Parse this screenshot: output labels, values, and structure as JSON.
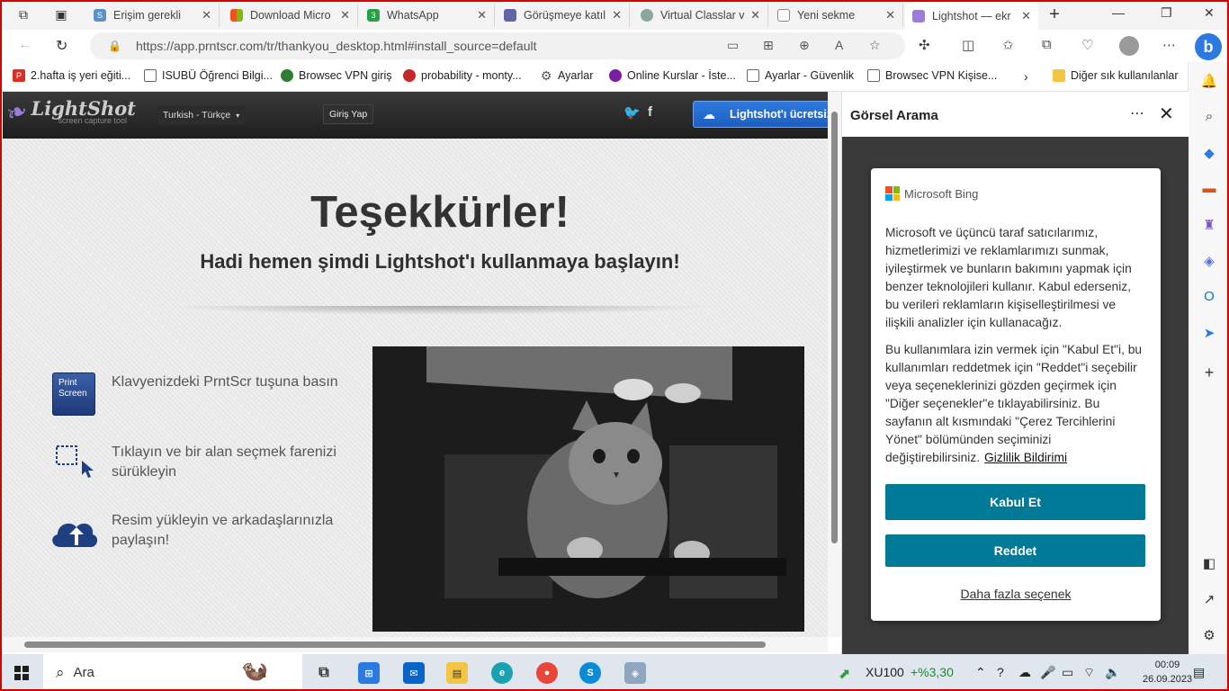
{
  "tabs": [
    {
      "label": "Erişim gerekli",
      "fav": "S",
      "color": "#5b93c9"
    },
    {
      "label": "Download Micro",
      "fav": "",
      "color": "#f25022"
    },
    {
      "label": "WhatsApp",
      "fav": "3",
      "color": "#25a244"
    },
    {
      "label": "Görüşmeye katıl",
      "fav": "",
      "color": "#6264a7"
    },
    {
      "label": "Virtual Classlar v",
      "fav": "",
      "color": "#8aa7a0"
    },
    {
      "label": "Yeni sekme",
      "fav": "",
      "color": "#999999"
    },
    {
      "label": "Lightshot — ekr",
      "fav": "",
      "color": "#9b7cd9"
    }
  ],
  "address": {
    "url": "https://app.prntscr.com/tr/thankyou_desktop.html#install_source=default"
  },
  "bookmarks": [
    {
      "label": "2.hafta iş yeri eğiti...",
      "color": "#d93025"
    },
    {
      "label": "ISUBÜ Öğrenci Bilgi...",
      "color": "#666666"
    },
    {
      "label": "Browsec VPN giriş",
      "color": "#2e7d32"
    },
    {
      "label": "probability - monty...",
      "color": "#c62828"
    },
    {
      "label": "Ayarlar",
      "color": "#555555"
    },
    {
      "label": "Online Kurslar - İste...",
      "color": "#7b1fa2"
    },
    {
      "label": "Ayarlar - Güvenlik",
      "color": "#666666"
    },
    {
      "label": "Browsec VPN Kişise...",
      "color": "#666666"
    }
  ],
  "bookmarks_other": "Diğer sık kullanılanlar",
  "lightshot": {
    "logo": "LightShot",
    "tagline": "screen capture tool",
    "language": "Turkish - Türkçe",
    "login": "Giriş Yap",
    "download": "Lightshot'ı ücretsiz",
    "title": "Teşekkürler!",
    "subtitle": "Hadi hemen şimdi Lightshot'ı kullanmaya başlayın!",
    "print_key": "Print Screen",
    "steps": [
      "Klavyenizdeki PrntScr tuşuna basın",
      "Tıklayın ve bir alan seçmek farenizi sürükleyin",
      "Resim yükleyin ve arkadaşlarınızla paylaşın!"
    ]
  },
  "panel": {
    "title": "Görsel Arama",
    "brand": "Microsoft Bing",
    "para1": "Microsoft ve üçüncü taraf satıcılarımız, hizmetlerimizi ve reklamlarımızı sunmak, iyileştirmek ve bunların bakımını yapmak için benzer teknolojileri kullanır. Kabul ederseniz, bu verileri reklamların kişiselleştirilmesi ve ilişkili analizler için kullanacağız.",
    "para2": "Bu kullanımlara izin vermek için \"Kabul Et\"i, bu kullanımları reddetmek için \"Reddet\"i seçebilir veya seçeneklerinizi gözden geçirmek için \"Diğer seçenekler\"e tıklayabilirsiniz. Bu sayfanın alt kısmındaki \"Çerez Tercihlerini Yönet\" bölümünden seçiminizi değiştirebilirsiniz.",
    "privacy": "Gizlilik Bildirimi",
    "accept": "Kabul Et",
    "reject": "Reddet",
    "more": "Daha fazla seçenek"
  },
  "taskbar": {
    "search_placeholder": "Ara",
    "ticker": "XU100",
    "ticker_change": "+%3,30",
    "time": "00:09",
    "date": "26.09.2023"
  }
}
